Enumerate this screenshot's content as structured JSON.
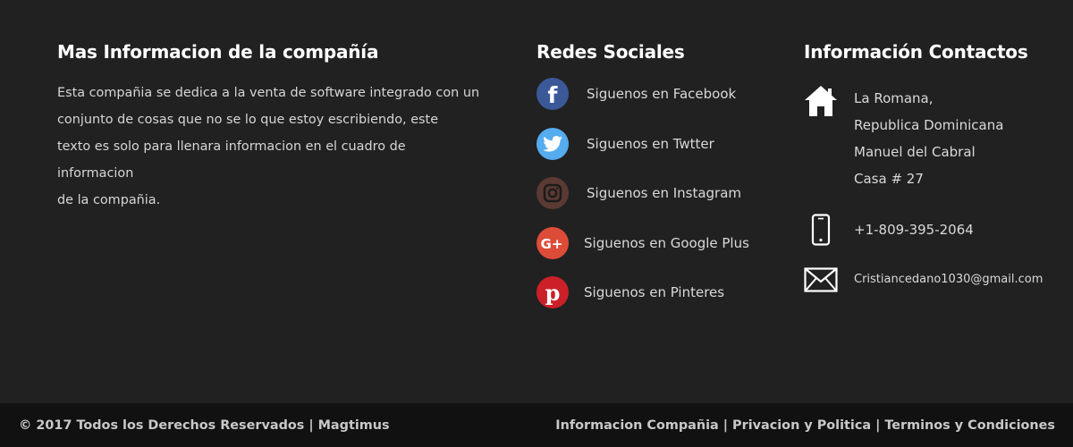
{
  "about": {
    "title": "Mas Informacion de la compañía",
    "lines": [
      "Esta compañia se dedica a la venta de software integrado con un",
      "conjunto de cosas que no se lo que estoy escribiendo, este",
      "texto es solo para llenara informacion en el cuadro de informacion",
      "de la compañia."
    ]
  },
  "social": {
    "title": "Redes Sociales",
    "items": [
      {
        "label": "Siguenos en Facebook",
        "icon": "facebook-icon",
        "color": "#3b5998"
      },
      {
        "label": "Siguenos en Twtter",
        "icon": "twitter-icon",
        "color": "#55acee"
      },
      {
        "label": "Siguenos en Instagram",
        "icon": "instagram-icon",
        "color": "#5b3a33"
      },
      {
        "label": "Siguenos en Google Plus",
        "icon": "google-plus-icon",
        "color": "#dd4b39"
      },
      {
        "label": "Siguenos en Pinteres",
        "icon": "pinterest-icon",
        "color": "#cb2027"
      }
    ]
  },
  "contact": {
    "title": "Información Contactos",
    "address": [
      "La Romana,",
      "Republica Dominicana",
      "Manuel del Cabral",
      "Casa # 27"
    ],
    "phone": "+1-809-395-2064",
    "email": "Cristiancedano1030@gmail.com"
  },
  "bottom": {
    "copyright": "© 2017 Todos los Derechos Reservados |",
    "brand": "Magtimus",
    "links": [
      "Informacion Compañia",
      "Privacion y Politica",
      "Terminos y Condiciones"
    ],
    "separator": "|"
  }
}
